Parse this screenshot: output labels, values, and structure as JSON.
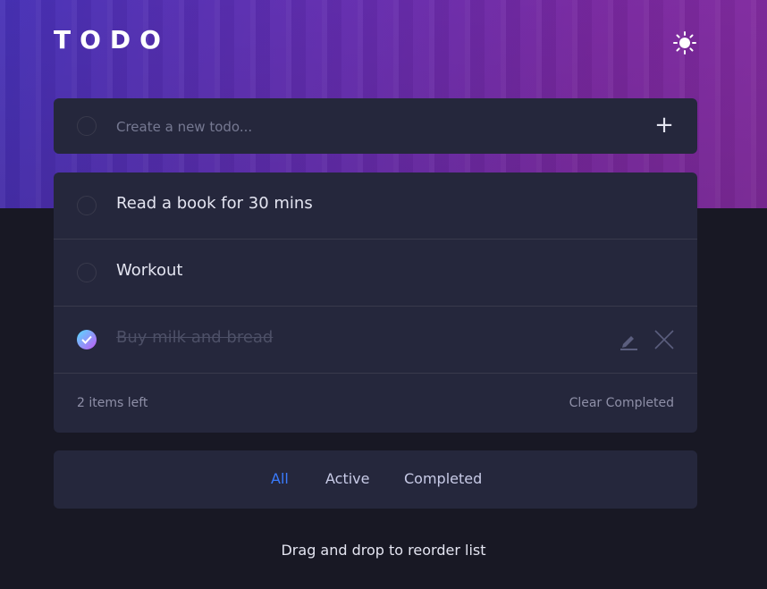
{
  "header": {
    "title": "TODO",
    "theme_icon": "sun-icon"
  },
  "new_todo": {
    "placeholder": "Create a new todo...",
    "add_label": "+"
  },
  "todos": [
    {
      "text": "Read a book for 30 mins",
      "completed": false
    },
    {
      "text": "Workout",
      "completed": false
    },
    {
      "text": "Buy milk and bread",
      "completed": true
    }
  ],
  "footer": {
    "items_left": "2 items left",
    "clear_label": "Clear Completed"
  },
  "filters": {
    "all": "All",
    "active": "Active",
    "completed": "Completed",
    "selected": "All"
  },
  "hint": "Drag and drop to reorder list",
  "colors": {
    "accent": "#3a7bfd",
    "card_bg": "#25273c",
    "page_bg": "#181824",
    "check_gradient_start": "#57ddff",
    "check_gradient_end": "#c058f3"
  }
}
